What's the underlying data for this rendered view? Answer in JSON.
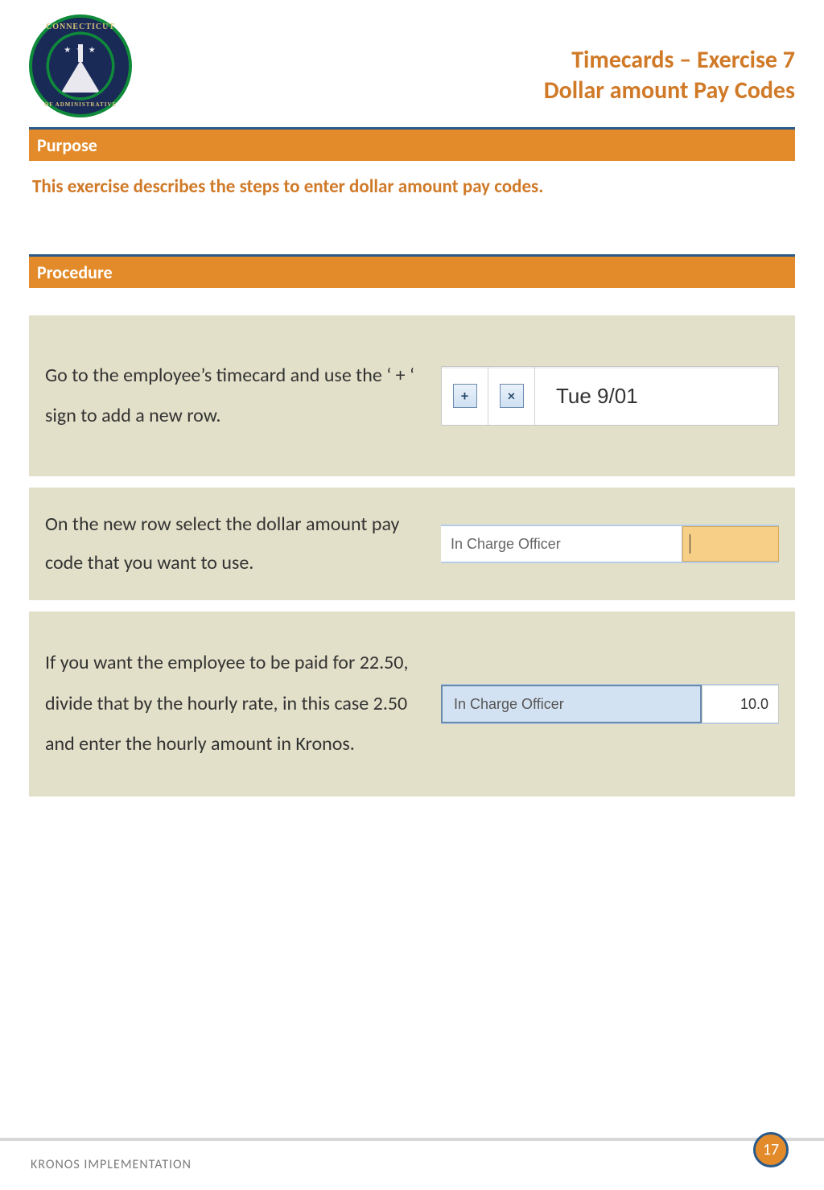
{
  "header": {
    "title_line1": "Timecards – Exercise 7",
    "title_line2": "Dollar amount Pay Codes",
    "seal_top": "CONNECTICUT",
    "seal_bottom": "OF ADMINISTRATIVE"
  },
  "sections": {
    "purpose_label": "Purpose",
    "procedure_label": "Procedure"
  },
  "purpose_text": "This exercise describes the steps to enter dollar amount pay codes.",
  "steps": [
    {
      "text": "Go to the employee’s timecard and use the ‘ + ‘ sign to add a new row.",
      "visual": {
        "plus": "+",
        "close": "×",
        "date": "Tue 9/01"
      }
    },
    {
      "text": "On the new row select the dollar amount pay code that you want to use.",
      "visual": {
        "paycode": "In Charge Officer"
      }
    },
    {
      "text": "If you want the employee to be paid for 22.50, divide that by the hourly rate, in this case 2.50 and enter the hourly amount in Kronos.",
      "visual": {
        "paycode": "In Charge Officer",
        "amount": "10.0"
      }
    }
  ],
  "footer": {
    "label": "KRONOS IMPLEMENTATION",
    "page": "17"
  }
}
